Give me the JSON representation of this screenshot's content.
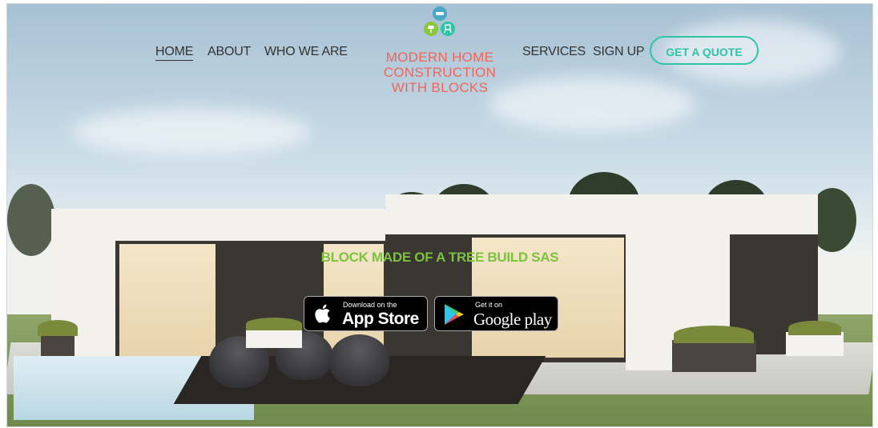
{
  "nav": {
    "home": "HOME",
    "about": "ABOUT",
    "who_we_are": "WHO WE ARE",
    "services": "SERVICES",
    "sign_up": "SIGN UP",
    "quote": "GET A QUOTE"
  },
  "logo": {
    "line1": "MODERN HOME",
    "line2": "CONSTRUCTION",
    "line3": "WITH BLOCKS",
    "text_color": "#f0655a",
    "icon_colors": [
      "#4aa7c5",
      "#8cc63f",
      "#2ec4a5"
    ]
  },
  "hero": {
    "tagline": "BLOCK MADE OF A TREE BUILD SAS",
    "tagline_color": "#7bc23d"
  },
  "badges": {
    "appstore_small": "Download on the",
    "appstore_big": "App Store",
    "google_small": "Get it on",
    "google_big": "Google play"
  },
  "colors": {
    "accent": "#2ec4a5"
  }
}
